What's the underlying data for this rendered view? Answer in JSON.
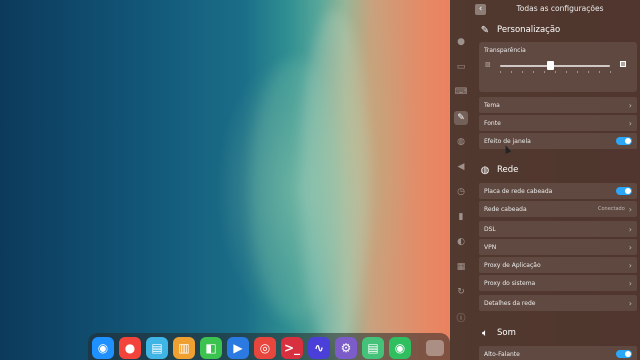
{
  "dock": {
    "apps": [
      {
        "icon": "launcher-icon",
        "glyph": "◉",
        "color": "#1e90ff"
      },
      {
        "icon": "screen-recorder-icon",
        "glyph": "●",
        "color": "#f2443a"
      },
      {
        "icon": "app-store-icon",
        "glyph": "▤",
        "color": "#3fb5e6"
      },
      {
        "icon": "archive-manager-icon",
        "glyph": "▥",
        "color": "#f0a030"
      },
      {
        "icon": "document-viewer-icon",
        "glyph": "◧",
        "color": "#3cc24e"
      },
      {
        "icon": "media-player-icon",
        "glyph": "▶",
        "color": "#2a7ae2"
      },
      {
        "icon": "chrome-icon",
        "glyph": "◎",
        "color": "#e8453c"
      },
      {
        "icon": "terminal-icon",
        "glyph": ">_",
        "color": "#d93040"
      },
      {
        "icon": "system-monitor-icon",
        "glyph": "∿",
        "color": "#4a3fd8"
      },
      {
        "icon": "settings-icon",
        "glyph": "⚙",
        "color": "#7b5cc9"
      },
      {
        "icon": "notes-icon",
        "glyph": "▤",
        "color": "#44c27a"
      },
      {
        "icon": "camera-icon",
        "glyph": "◉",
        "color": "#2fbf60"
      }
    ]
  },
  "panel": {
    "title": "Todas as configurações",
    "nav_icons": [
      "user-icon",
      "display-icon",
      "keyboard-icon",
      "personalization-icon",
      "network-icon",
      "sound-icon",
      "time-icon",
      "power-icon",
      "mouse-icon",
      "grid-icon",
      "update-icon",
      "info-icon"
    ],
    "personalization": {
      "title": "Personalização",
      "transparency_label": "Transparência",
      "transparency_level": 0.45,
      "rows": [
        {
          "label": "Tema"
        },
        {
          "label": "Fonte"
        }
      ],
      "window_effect": {
        "label": "Efeito de janela",
        "enabled": true
      }
    },
    "network": {
      "title": "Rede",
      "wired_card": "Placa de rede cabeada",
      "wired_status": "Conectado",
      "wired_network": "Rede cabeada",
      "rows": [
        {
          "label": "DSL"
        },
        {
          "label": "VPN"
        },
        {
          "label": "Proxy de Aplicação"
        },
        {
          "label": "Proxy do sistema"
        }
      ],
      "details": "Detalhes da rede"
    },
    "sound": {
      "title": "Som",
      "speaker": "Alto-Falante"
    }
  },
  "colors": {
    "accent": "#2ca7f8"
  }
}
